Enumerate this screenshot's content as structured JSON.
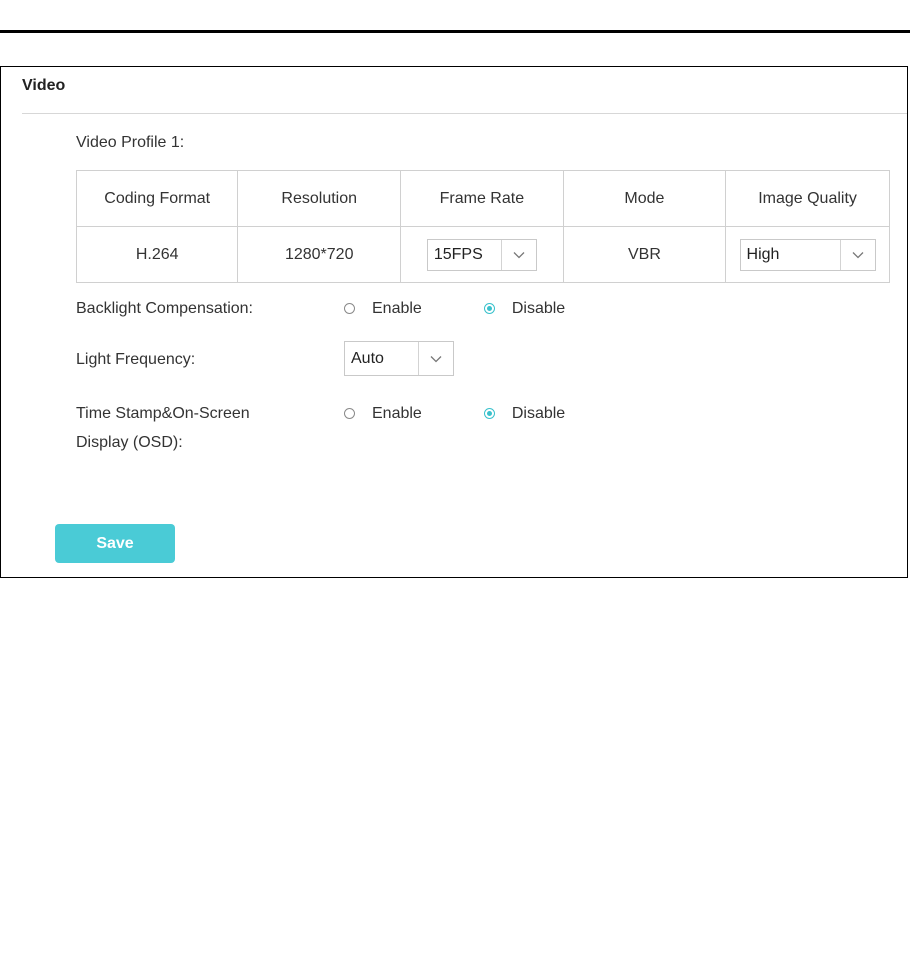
{
  "section": {
    "title": "Video"
  },
  "profile": {
    "label": "Video Profile 1:",
    "headers": [
      "Coding Format",
      "Resolution",
      "Frame Rate",
      "Mode",
      "Image Quality"
    ],
    "row": {
      "coding_format": "H.264",
      "resolution": "1280*720",
      "frame_rate": "15FPS",
      "mode": "VBR",
      "image_quality": "High"
    }
  },
  "backlight": {
    "label": "Backlight Compensation:",
    "options": [
      "Enable",
      "Disable"
    ],
    "selected": "Disable"
  },
  "light_frequency": {
    "label": "Light Frequency:",
    "value": "Auto"
  },
  "osd": {
    "label_line1": "Time Stamp&On-Screen",
    "label_line2": "Display (OSD):",
    "options": [
      "Enable",
      "Disable"
    ],
    "selected": "Disable"
  },
  "save_label": "Save",
  "colors": {
    "accent": "#4acbd6",
    "radio_active": "#39c1cc"
  },
  "icons": {
    "dropdown": "chevron-down-icon"
  }
}
